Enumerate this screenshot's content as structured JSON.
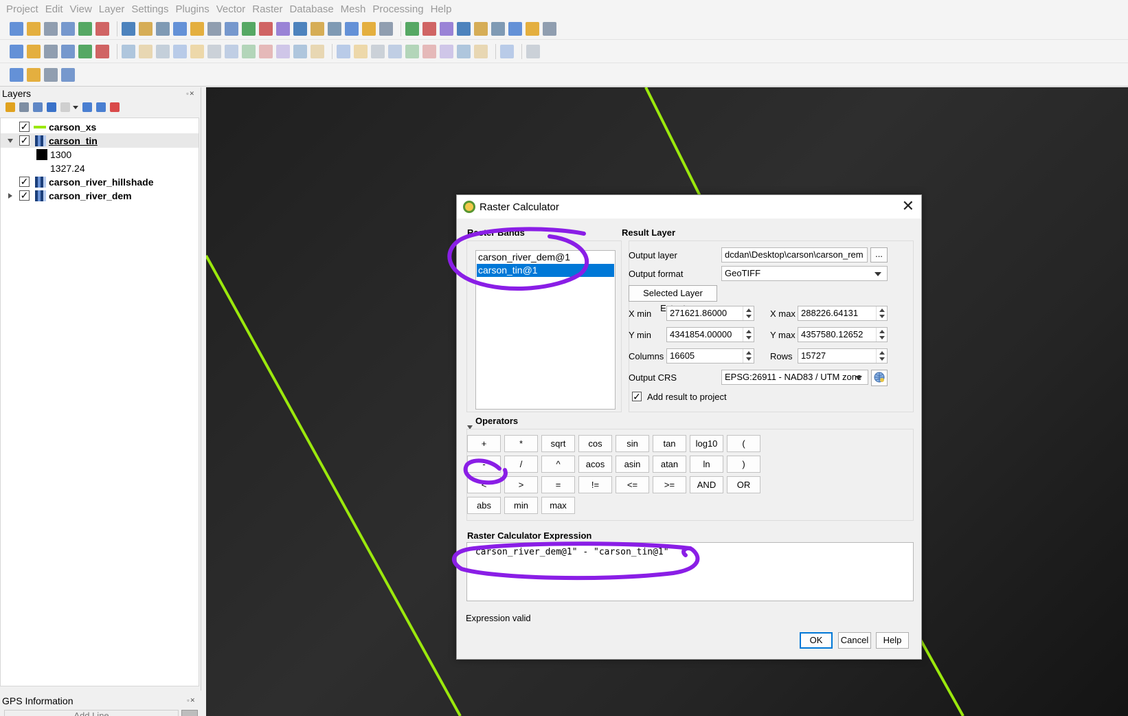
{
  "menu": [
    "Project",
    "Edit",
    "View",
    "Layer",
    "Settings",
    "Plugins",
    "Vector",
    "Raster",
    "Database",
    "Mesh",
    "Processing",
    "Help"
  ],
  "toolbar_icons": {
    "row1": [
      "new-project-icon",
      "open-project-icon",
      "save-project-icon",
      "save-as-icon",
      "print-layout-icon",
      "style-manager-icon",
      "|",
      "pan-icon",
      "pan-to-selection-icon",
      "zoom-in-icon",
      "zoom-out-icon",
      "zoom-full-icon",
      "zoom-to-selection-icon",
      "zoom-to-layer-icon",
      "zoom-native-icon",
      "zoom-last-icon",
      "zoom-next-icon",
      "new-map-view-icon",
      "new-3d-view-icon",
      "bookmark-icon",
      "show-bookmarks-icon",
      "temporal-controller-icon",
      "refresh-icon",
      "|",
      "identify-icon",
      "attribute-table-icon",
      "field-calculator-icon",
      "processing-toolbox-icon",
      "statistics-icon",
      "measure-icon",
      "map-tips-icon",
      "search-icon",
      "text-annotation-icon"
    ],
    "row2": [
      "data-source-manager-icon",
      "new-geopackage-icon",
      "new-shapefile-icon",
      "digitize-icon",
      "new-virtual-layer-icon",
      "checkbox-icon",
      "|",
      "edit-pencil-icon",
      "edit-toggle-icon",
      "save-edits-icon",
      "vertex-tool-icon",
      "node-tool-icon",
      "modify-attributes-icon",
      "delete-icon",
      "cut-icon",
      "copy-icon",
      "paste-icon",
      "undo-icon",
      "redo-icon",
      "|",
      "label-icon",
      "label-pin-icon",
      "label-abc-icon",
      "label-abc-red-icon",
      "label-move-icon",
      "label-rotate-icon",
      "label-change-icon",
      "label-show-hide-icon",
      "label-toggle-icon",
      "|",
      "python-icon",
      "|",
      "help-icon"
    ],
    "row3": [
      "select-features-icon",
      "deselect-icon",
      "select-by-expression-icon",
      "show-map-tip-icon"
    ]
  },
  "layers_panel": {
    "title": "Layers",
    "items": [
      {
        "name": "carson_xs",
        "type": "line",
        "checked": true,
        "color": "#9be80d"
      },
      {
        "name": "carson_tin",
        "type": "raster",
        "checked": true,
        "expanded": true,
        "legend": [
          "1300",
          "1327.24"
        ]
      },
      {
        "name": "carson_river_hillshade",
        "type": "raster",
        "checked": true
      },
      {
        "name": "carson_river_dem",
        "type": "raster",
        "checked": true,
        "expanded": false
      }
    ]
  },
  "gps_panel": {
    "title": "GPS Information",
    "add_line": "Add Line"
  },
  "dialog": {
    "title": "Raster Calculator",
    "raster_bands_label": "Raster Bands",
    "bands": [
      "carson_river_dem@1",
      "carson_tin@1"
    ],
    "selected_band_index": 1,
    "result_layer_label": "Result Layer",
    "output_layer_label": "Output layer",
    "output_layer_value": "dcdan\\Desktop\\carson\\carson_rem",
    "browse_label": "...",
    "output_format_label": "Output format",
    "output_format_value": "GeoTIFF",
    "selected_extent_label": "Selected Layer Extent",
    "xmin_label": "X min",
    "xmin_value": "271621.86000",
    "xmax_label": "X max",
    "xmax_value": "288226.64131",
    "ymin_label": "Y min",
    "ymin_value": "4341854.00000",
    "ymax_label": "Y max",
    "ymax_value": "4357580.12652",
    "columns_label": "Columns",
    "columns_value": "16605",
    "rows_label": "Rows",
    "rows_value": "15727",
    "crs_label": "Output CRS",
    "crs_value": "EPSG:26911 - NAD83 / UTM zone",
    "add_result_label": "Add result to project",
    "add_result_checked": true,
    "operators_label": "Operators",
    "operators": [
      [
        "+",
        "*",
        "sqrt",
        "cos",
        "sin",
        "tan",
        "log10",
        "("
      ],
      [
        "-",
        "/",
        "^",
        "acos",
        "asin",
        "atan",
        "ln",
        ")"
      ],
      [
        "<",
        ">",
        "=",
        "!=",
        "<=",
        ">=",
        "AND",
        "OR"
      ],
      [
        "abs",
        "min",
        "max"
      ]
    ],
    "expression_label": "Raster Calculator Expression",
    "expression": "\"carson_river_dem@1\" - \"carson_tin@1\"",
    "status": "Expression valid",
    "ok_label": "OK",
    "cancel_label": "Cancel",
    "help_label": "Help"
  },
  "annotation_color": "#8a1ee6",
  "map_line_color": "#9be80d"
}
